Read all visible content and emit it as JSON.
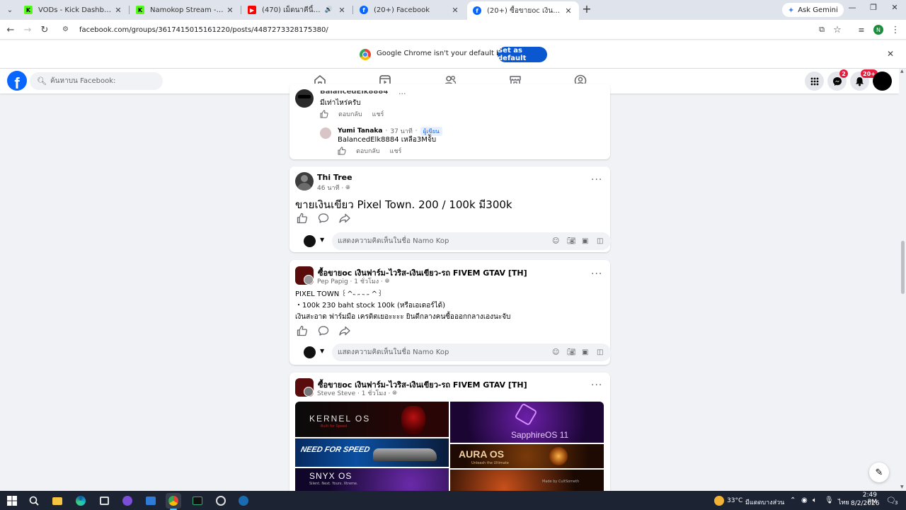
{
  "browser": {
    "tabs": [
      {
        "title": "VODs - Kick Dashboard",
        "icon": "kick-icon",
        "color": "#53fc18"
      },
      {
        "title": "Namokop Stream - Watch Live",
        "icon": "kick-icon",
        "color": "#53fc18"
      },
      {
        "title": "(470) เม็ดนาคีนี้บ้มนแลทแลยว้",
        "icon": "youtube-icon",
        "color": "#ff0000"
      },
      {
        "title": "(20+) Facebook",
        "icon": "facebook-icon",
        "color": "#0866ff"
      },
      {
        "title": "(20+) ซื้อขายoc เงินฟาร์ม-ไวริส-เงิน",
        "icon": "facebook-icon",
        "color": "#0866ff"
      }
    ],
    "ask_gemini": "Ask Gemini",
    "url": "facebook.com/groups/3617415015161220/posts/4487273328175380/",
    "profile_letter": "N",
    "infobar_message": "Google Chrome isn't your default browser",
    "infobar_button": "Set as default"
  },
  "facebook": {
    "search_placeholder": "ค้นหาบน Facebook:",
    "messenger_badge": "2",
    "notifications_badge": "20+"
  },
  "comments": {
    "top_comment": {
      "author": "BalancedElk8884",
      "text": "มีเท่าไหร่ครับ",
      "like": "",
      "reply": "ตอบกลับ",
      "share": "แชร์"
    },
    "reply_comment": {
      "author": "Yumi Tanaka",
      "time": "37 นาที",
      "badge": "ผู้เขียน",
      "text": "BalancedElk8884 เหลือ3Mจ้ับ",
      "reply": "ตอบกลับ",
      "share": "แชร์"
    }
  },
  "posts": [
    {
      "author": "Thi Tree",
      "meta": "46 นาที ·",
      "text": "ขายเงินเขียว Pixel Town. 200 / 100k มี300k",
      "comment_placeholder": "แสดงความคิดเห็นในชื่อ Namo Kop"
    },
    {
      "group": "ซื้อขายoc เงินฟาร์ม-ไวริส-เงินเขียว-รถ FIVEM GTAV [TH]",
      "author": "Pep Papig",
      "meta": "Pep Papig · 1 ชั่วโมง ·",
      "line1": "PIXEL TOWN  ꒰^˵ ˶ ˵ ˶ ^꒱ ",
      "line2": "・100k 230 baht stock 100k (หรือเอเดอร์ได้)",
      "line3": "เงินสะอาด ฟาร์มมือ เครดิตเยอะะะะ ยินดีกลางคนซื้อออกกลางเองนะจับ",
      "comment_placeholder": "แสดงความคิดเห็นในชื่อ Namo Kop"
    },
    {
      "group": "ซื้อขายoc เงินฟาร์ม-ไวริส-เงินเขียว-รถ FIVEM GTAV [TH]",
      "meta": "Steve Steve · 1 ชั่วโมง ·",
      "images": [
        {
          "title": "KERNEL OS",
          "subtitle": "Built for Speed",
          "bg": "#111111"
        },
        {
          "title": "SapphireOS 11",
          "subtitle": "",
          "bg": "#2a0b4a"
        },
        {
          "title": "NEED FOR SPEED",
          "subtitle": "",
          "bg": "#0a2a55"
        },
        {
          "title": "AURA OS",
          "subtitle": "Unleash the Ultimate",
          "bg": "#2b1205"
        },
        {
          "title": "SNYX OS",
          "subtitle": "Silent. Next. Yours. Xtreme.",
          "bg": "#140b2b"
        },
        {
          "title": "",
          "subtitle": "Made by CultSometh",
          "bg": "#1a0e05"
        }
      ]
    }
  ],
  "taskbar": {
    "weather": "33°C",
    "weather_text": "มีแดดบางส่วน",
    "lang": "ไทย",
    "time": "2:49 PM",
    "date": "8/2/2026",
    "notif_count": "3"
  }
}
